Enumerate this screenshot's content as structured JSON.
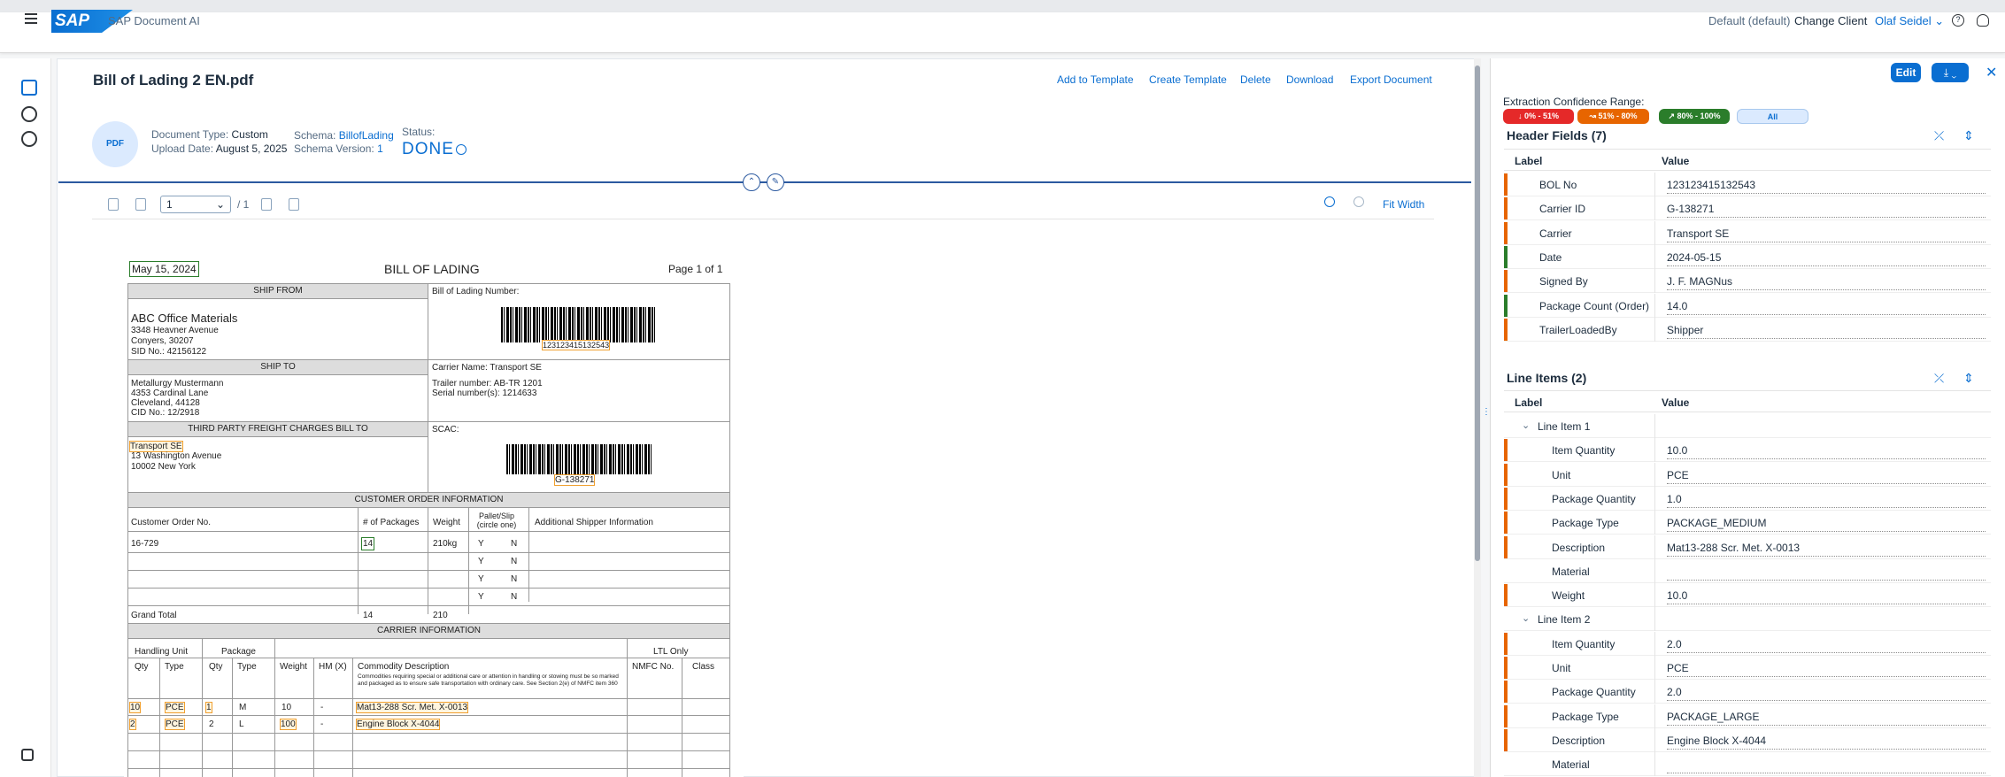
{
  "shell": {
    "app_title": "SAP Document AI",
    "logo": "SAP",
    "client_label": "Default (default)",
    "change_client": "Change Client",
    "user": "Olaf Seidel ⌄"
  },
  "document": {
    "title": "Bill of Lading 2 EN.pdf",
    "actions": [
      "Add to Template",
      "Create Template",
      "Delete",
      "Download",
      "Export Document"
    ],
    "badge": "PDF",
    "type_label": "Document Type:",
    "type_value": "Custom",
    "upload_label": "Upload Date:",
    "upload_value": "August 5, 2025",
    "schema_label": "Schema:",
    "schema_value": "BillofLading",
    "schema_ver_label": "Schema Version:",
    "schema_ver_value": "1",
    "status_label": "Status:",
    "status_value": "DONE"
  },
  "viewer": {
    "page": "1",
    "page_total": "/ 1",
    "fit_width": "Fit Width"
  },
  "pdf": {
    "date": "May 15, 2024",
    "title": "BILL OF LADING",
    "page_of": "Page 1 of 1",
    "ship_from": "SHIP FROM",
    "bol_number_label": "Bill of Lading Number:",
    "shipper_name": "ABC Office Materials",
    "shipper_addr1": "3348 Heavner Avenue",
    "shipper_addr2": "Conyers, 30207",
    "shipper_sid": "SID No.: 42156122",
    "barcode1": "123123415132543",
    "ship_to": "SHIP TO",
    "carrier_name": "Carrier Name: Transport SE",
    "trailer": "Trailer number: AB-TR 1201",
    "serial": "Serial number(s): 1214633",
    "consignee": "Metallurgy Mustermann",
    "consignee_addr1": "4353 Cardinal Lane",
    "consignee_addr2": "Cleveland, 44128",
    "consignee_cid": "CID No.: 12/2918",
    "third_party": "THIRD PARTY FREIGHT CHARGES BILL TO",
    "scac": "SCAC:",
    "tp_name": "Transport SE",
    "tp_addr1": "13 Washington Avenue",
    "tp_addr2": "10002 New York",
    "barcode2": "G-138271",
    "cust_order_info": "CUSTOMER ORDER INFORMATION",
    "col_order": "Customer Order No.",
    "col_packages": "# of Packages",
    "col_weight": "Weight",
    "col_pallet": "Pallet/Slip (circle one)",
    "col_addl": "Additional Shipper Information",
    "order_no": "16-729",
    "order_pkgs": "14",
    "order_weight": "210kg",
    "y": "Y",
    "n": "N",
    "grand_total": "Grand Total",
    "gt_pkgs": "14",
    "gt_weight": "210",
    "carrier_info": "CARRIER INFORMATION",
    "handling_unit": "Handling Unit",
    "package": "Package",
    "ltl_only": "LTL Only",
    "qty": "Qty",
    "type": "Type",
    "weight": "Weight",
    "hm": "HM (X)",
    "commodity": "Commodity Description",
    "nmfc": "NMFC No.",
    "class": "Class",
    "commodity_note": "Commodities requiring special or additional care or attention in handling or stowing must be so marked and packaged as to ensure safe transportation with ordinary care. See Section 2(e) of NMFC item 360",
    "r1": [
      "10",
      "PCE",
      "1",
      "M",
      "10",
      "-",
      "Mat13-288 Scr. Met. X-0013"
    ],
    "r2": [
      "2",
      "PCE",
      "2",
      "L",
      "100",
      "-",
      "Engine Block X-4044"
    ]
  },
  "panel": {
    "edit": "Edit",
    "download": "⤓ ⌄",
    "confidence_label": "Extraction Confidence Range:",
    "chips": [
      {
        "label": "↓ 0% - 51%",
        "color": "#e52929"
      },
      {
        "label": "↝ 51% - 80%",
        "color": "#e76500"
      },
      {
        "label": "↗ 80% - 100%",
        "color": "#2b7d2b"
      },
      {
        "label": "All",
        "color": "#dbeafe"
      }
    ],
    "header_title": "Header Fields (7)",
    "col_label": "Label",
    "col_value": "Value",
    "header_fields": [
      {
        "label": "BOL No",
        "value": "123123415132543",
        "bar": "#e76500"
      },
      {
        "label": "Carrier ID",
        "value": "G-138271",
        "bar": "#e76500"
      },
      {
        "label": "Carrier",
        "value": "Transport SE",
        "bar": "#e76500"
      },
      {
        "label": "Date",
        "value": "2024-05-15",
        "bar": "#2b7d2b"
      },
      {
        "label": "Signed By",
        "value": "J. F. MAGNus",
        "bar": "#e76500"
      },
      {
        "label": "Package Count (Order)",
        "value": "14.0",
        "bar": "#2b7d2b"
      },
      {
        "label": "TrailerLoadedBy",
        "value": "Shipper",
        "bar": "#e76500"
      }
    ],
    "line_title": "Line Items (2)",
    "line_items": [
      {
        "group": "Line Item 1"
      },
      {
        "label": "Item Quantity",
        "value": "10.0",
        "bar": "#e76500"
      },
      {
        "label": "Unit",
        "value": "PCE",
        "bar": "#e76500"
      },
      {
        "label": "Package Quantity",
        "value": "1.0",
        "bar": "#e76500"
      },
      {
        "label": "Package Type",
        "value": "PACKAGE_MEDIUM",
        "bar": "#e76500"
      },
      {
        "label": "Description",
        "value": "Mat13-288 Scr. Met. X-0013",
        "bar": "#e76500"
      },
      {
        "label": "Material",
        "value": "",
        "bar": ""
      },
      {
        "label": "Weight",
        "value": "10.0",
        "bar": "#e76500"
      },
      {
        "group": "Line Item 2"
      },
      {
        "label": "Item Quantity",
        "value": "2.0",
        "bar": "#e76500"
      },
      {
        "label": "Unit",
        "value": "PCE",
        "bar": "#e76500"
      },
      {
        "label": "Package Quantity",
        "value": "2.0",
        "bar": "#e76500"
      },
      {
        "label": "Package Type",
        "value": "PACKAGE_LARGE",
        "bar": "#e76500"
      },
      {
        "label": "Description",
        "value": "Engine Block X-4044",
        "bar": "#e76500"
      },
      {
        "label": "Material",
        "value": "",
        "bar": ""
      }
    ]
  }
}
